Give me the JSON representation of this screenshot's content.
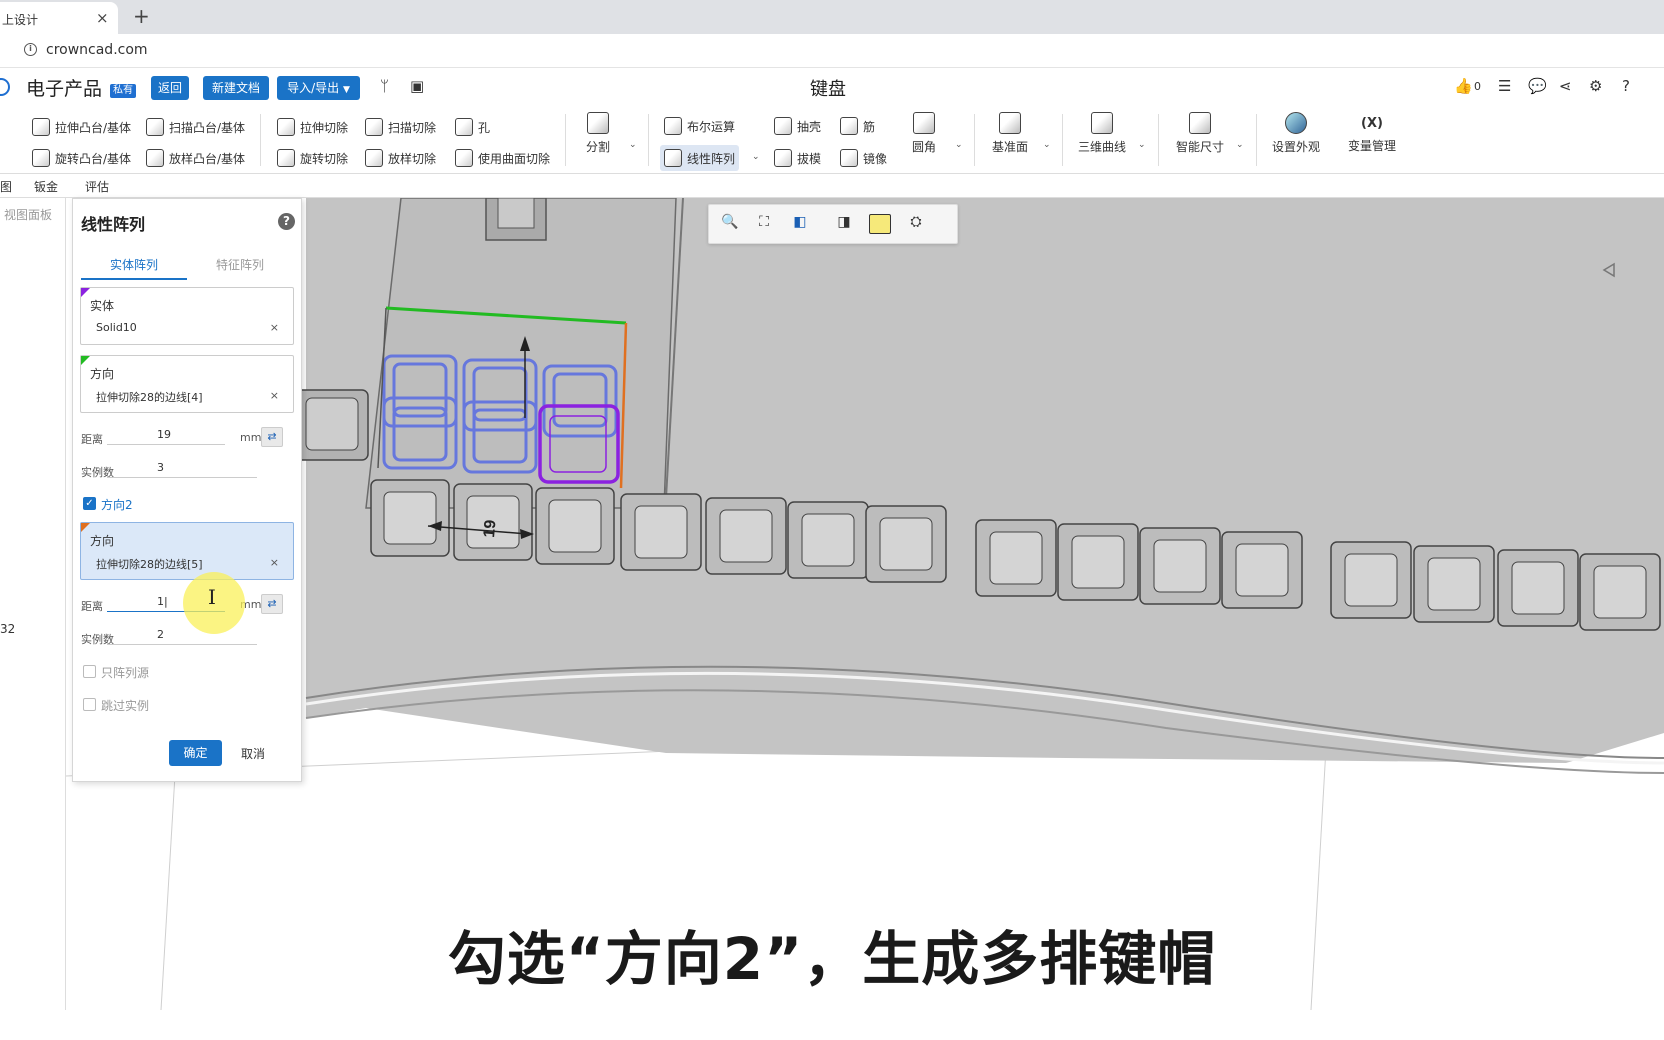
{
  "browser": {
    "tab_title": "上设计",
    "tab_close": "×",
    "new_tab": "+",
    "url": "crowncad.com"
  },
  "header": {
    "app_name": "电子产品",
    "private_badge": "私有",
    "back_label": "返回",
    "new_doc_label": "新建文档",
    "import_export_label": "导入/导出",
    "doc_title": "键盘",
    "like_count": "0"
  },
  "toolbar": {
    "extrude_boss": "拉伸凸台/基体",
    "revolve_boss": "旋转凸台/基体",
    "sweep_boss": "扫描凸台/基体",
    "loft_boss": "放样凸台/基体",
    "extrude_cut": "拉伸切除",
    "revolve_cut": "旋转切除",
    "sweep_cut": "扫描切除",
    "loft_cut": "放样切除",
    "hole": "孔",
    "surface_cut": "使用曲面切除",
    "split": "分割",
    "boolean": "布尔运算",
    "linear_pattern": "线性阵列",
    "shell": "抽壳",
    "rib": "筋",
    "draft": "拔模",
    "mirror": "镜像",
    "fillet": "圆角",
    "datum_plane": "基准面",
    "curve_3d": "三维曲线",
    "smart_dimension": "智能尺寸",
    "appearance": "设置外观",
    "variables": "变量管理",
    "variables_icon": "(X)"
  },
  "menu": {
    "item_cut": "图",
    "sheet_metal": "钣金",
    "evaluate": "评估"
  },
  "sidebar": {
    "view_panel": "视图面板",
    "side_number": "32"
  },
  "panel": {
    "title": "线性阵列",
    "help": "?",
    "tab_body": "实体阵列",
    "tab_feature": "特征阵列",
    "body_label": "实体",
    "body_value": "Solid10",
    "dir1_label": "方向",
    "dir1_value": "拉伸切除28的边线[4]",
    "distance_label": "距离",
    "distance1_value": "19",
    "unit": "mm",
    "count_label": "实例数",
    "count1_value": "3",
    "dir2_check_label": "方向2",
    "dir2_label": "方向",
    "dir2_value": "拉伸切除28的边线[5]",
    "distance2_value": "1|",
    "count2_value": "2",
    "only_seed_label": "只阵列源",
    "skip_instance_label": "跳过实例",
    "ok_label": "确定",
    "cancel_label": "取消",
    "remove_glyph": "×",
    "checkmark_glyph": "✓"
  },
  "viewport": {
    "dimension_label": "19"
  },
  "caption": "勾选“方向2”，生成多排键帽",
  "colors": {
    "accent": "#1a73c7",
    "selection_purple": "#8b22e0",
    "pattern_preview": "#6677dd",
    "direction_green": "#22bb22",
    "direction_orange": "#e07020"
  }
}
